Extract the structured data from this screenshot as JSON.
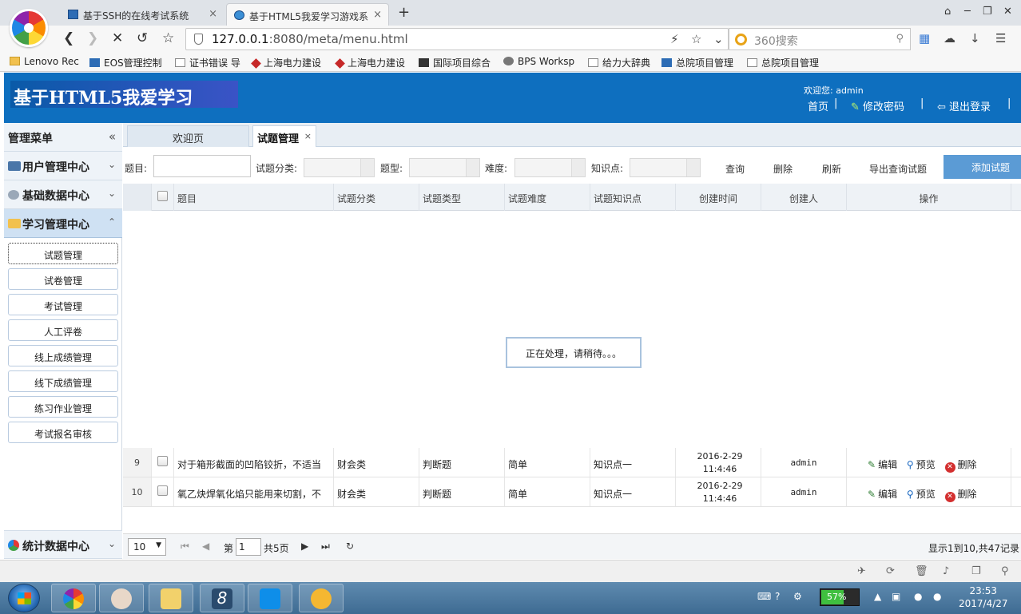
{
  "browser": {
    "tabs": [
      {
        "label": "基于SSH的在线考试系统",
        "close": "×"
      },
      {
        "label": "基于HTML5我爱学习游戏系",
        "close": "×"
      }
    ],
    "new_tab": "+",
    "url_host": "127.0.0.1",
    "url_rest": ":8080/meta/menu.html",
    "search_placeholder": "360搜索",
    "bookmarks": [
      "Lenovo Rec",
      "EOS管理控制",
      "证书错误 导",
      "上海电力建设",
      "上海电力建设",
      "国际项目综合",
      "BPS Worksp",
      "给力大辞典",
      "总院项目管理",
      "总院项目管理"
    ]
  },
  "header": {
    "title": "基于HTML5我爱学习",
    "welcome": "欢迎您: admin",
    "home": "首页",
    "change_password": "修改密码",
    "logout": "退出登录"
  },
  "sidebar": {
    "title": "管理菜单",
    "collapse_icon": "«",
    "sections": [
      {
        "label": "用户管理中心",
        "chevron": "⌄"
      },
      {
        "label": "基础数据中心",
        "chevron": "⌄"
      },
      {
        "label": "学习管理中心",
        "chevron": "⌃"
      }
    ],
    "items": [
      "试题管理",
      "试卷管理",
      "考试管理",
      "人工评卷",
      "线上成绩管理",
      "线下成绩管理",
      "练习作业管理",
      "考试报名审核"
    ],
    "bottom_section": {
      "label": "统计数据中心",
      "chevron": "⌄"
    }
  },
  "content_tabs": [
    {
      "label": "欢迎页"
    },
    {
      "label": "试题管理",
      "close": "×"
    }
  ],
  "toolbar": {
    "labels": {
      "title": "题目:",
      "category": "试题分类:",
      "type": "题型:",
      "difficulty": "难度:",
      "knowledge": "知识点:"
    },
    "buttons": {
      "query": "查询",
      "delete": "删除",
      "refresh": "刷新",
      "export": "导出查询试题",
      "add": "添加试题"
    }
  },
  "grid": {
    "columns": [
      "题目",
      "试题分类",
      "试题类型",
      "试题难度",
      "试题知识点",
      "创建时间",
      "创建人",
      "操作"
    ],
    "rows": [
      {
        "num": "9",
        "title": "对于箱形截面的凹陷铰折，不适当",
        "category": "财会类",
        "type": "判断题",
        "difficulty": "简单",
        "knowledge": "知识点一",
        "date": "2016-2-29",
        "time": "11:4:46",
        "creator": "admin"
      },
      {
        "num": "10",
        "title": "氧乙炔焊氧化焰只能用来切割，不",
        "category": "财会类",
        "type": "判断题",
        "difficulty": "简单",
        "knowledge": "知识点一",
        "date": "2016-2-29",
        "time": "11:4:46",
        "creator": "admin"
      }
    ],
    "actions": {
      "edit": "编辑",
      "preview": "预览",
      "delete": "删除"
    },
    "loading": "正在处理，请稍待。。。"
  },
  "pager": {
    "page_size": "10",
    "page_prefix": "第",
    "page_value": "1",
    "page_total": "共5页",
    "info": "显示1到10,共47记录"
  },
  "taskbar": {
    "battery": "57%",
    "time": "23:53",
    "date": "2017/4/27"
  },
  "colors": {
    "header_blue": "#0e6fbf",
    "add_button": "#5b9bd5",
    "active_section": "#cfe1f3"
  }
}
